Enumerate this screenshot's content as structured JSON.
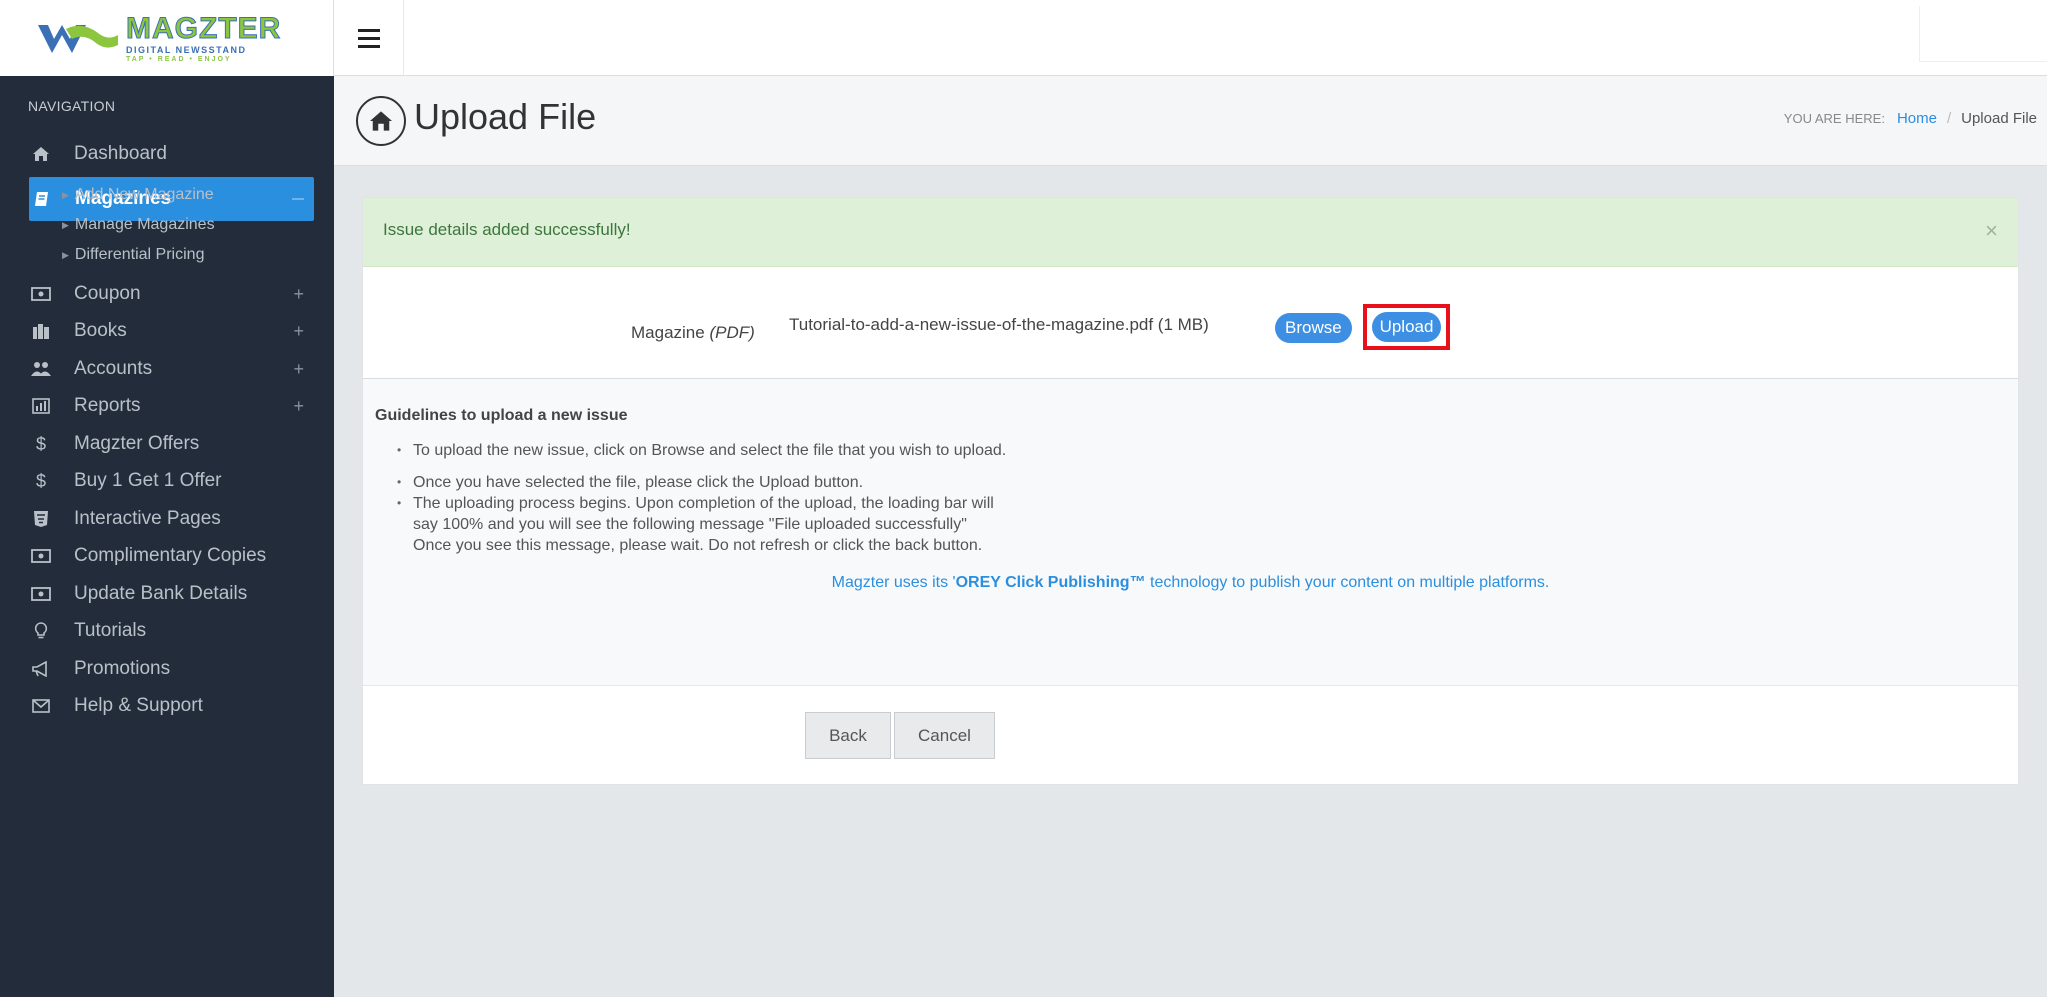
{
  "logo": {
    "brand": "MAGZTER",
    "sub1": "DIGITAL NEWSSTAND",
    "sub2": "TAP • READ • ENJOY"
  },
  "sidebar": {
    "heading": "NAVIGATION",
    "items": [
      {
        "label": "Dashboard",
        "icon": "home-icon"
      },
      {
        "label": "Magazines",
        "icon": "book-icon",
        "active": true
      },
      {
        "label": "Coupon",
        "icon": "ticket-icon",
        "expand": "+"
      },
      {
        "label": "Books",
        "icon": "books-icon",
        "expand": "+"
      },
      {
        "label": "Accounts",
        "icon": "users-icon",
        "expand": "+"
      },
      {
        "label": "Reports",
        "icon": "bar-chart-icon",
        "expand": "+"
      },
      {
        "label": "Magzter Offers",
        "icon": "dollar-icon"
      },
      {
        "label": "Buy 1 Get 1 Offer",
        "icon": "dollar-icon"
      },
      {
        "label": "Interactive Pages",
        "icon": "html5-icon"
      },
      {
        "label": "Complimentary Copies",
        "icon": "ticket-icon"
      },
      {
        "label": "Update Bank Details",
        "icon": "ticket-icon"
      },
      {
        "label": "Tutorials",
        "icon": "lightbulb-icon"
      },
      {
        "label": "Promotions",
        "icon": "megaphone-icon"
      },
      {
        "label": "Help & Support",
        "icon": "envelope-icon"
      }
    ],
    "subitems": [
      "Add New Magazine",
      "Manage Magazines",
      "Differential Pricing"
    ]
  },
  "header": {
    "title": "Upload File",
    "breadcrumb_label": "YOU ARE HERE:",
    "breadcrumb_home": "Home",
    "breadcrumb_sep": "/",
    "breadcrumb_current": "Upload File"
  },
  "alert": {
    "message": "Issue details added successfully!",
    "close": "×"
  },
  "upload": {
    "label": "Magazine",
    "label_type": "(PDF)",
    "file_name": "Tutorial-to-add-a-new-issue-of-the-magazine.pdf (1 MB)",
    "browse_label": "Browse",
    "upload_label": "Upload"
  },
  "guidelines": {
    "title": "Guidelines to upload a new issue",
    "items": [
      "To upload the new issue, click on Browse and select the file that you wish to upload.",
      "Once you have selected the file, please click the Upload button.",
      "The uploading process begins. Upon completion of the upload, the loading bar will say 100% and you will see the following message \"File uploaded successfully\" Once you see this message, please wait. Do not refresh or click the back button."
    ],
    "orey_pre": "Magzter uses its '",
    "orey_bold": "OREY Click Publishing™",
    "orey_post": " technology to publish your content on multiple platforms."
  },
  "footer": {
    "back_label": "Back",
    "cancel_label": "Cancel"
  },
  "colors": {
    "sidebar_bg": "#222c3b",
    "accent": "#2b8fe0",
    "alert_bg": "#dff0d8",
    "highlight": "#e8101a"
  }
}
